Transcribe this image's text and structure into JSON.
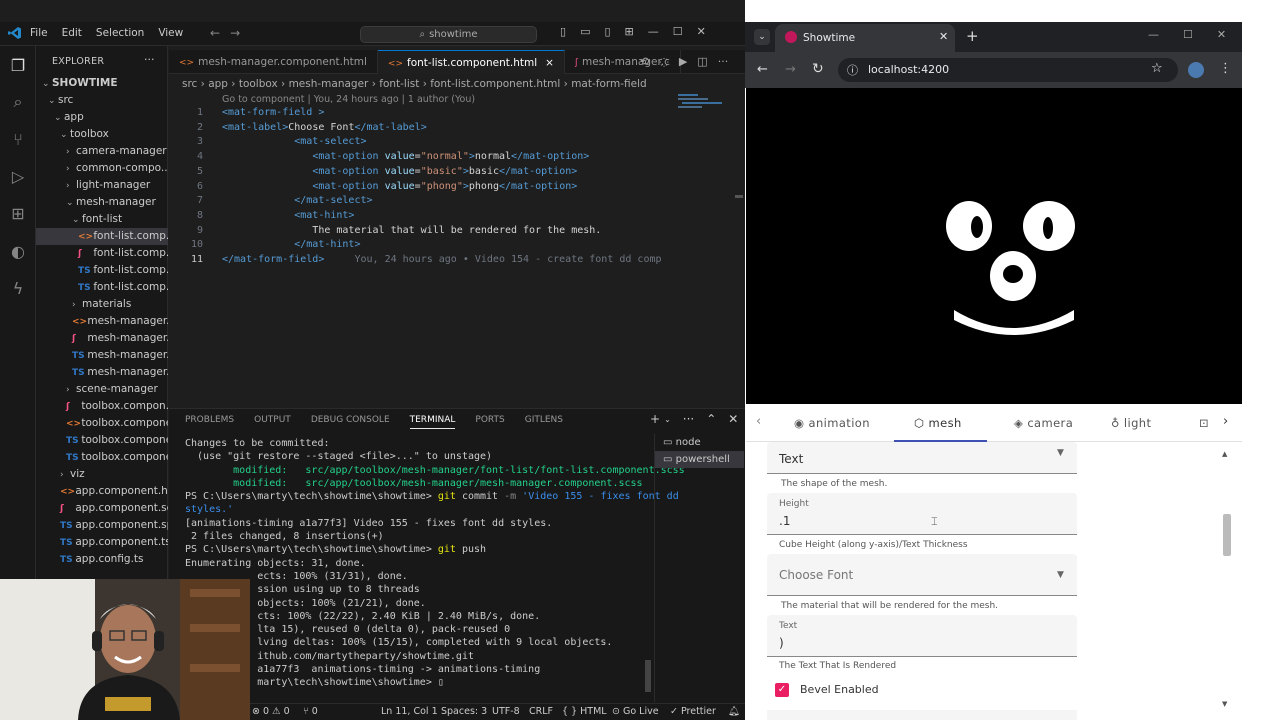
{
  "vscode": {
    "menu": [
      "File",
      "Edit",
      "Selection",
      "View"
    ],
    "command_center": "showtime",
    "explorer_title": "EXPLORER",
    "explorer_more": "···",
    "tree": [
      {
        "label": "SHOWTIME",
        "indent": 0,
        "chev": "⌄",
        "icon": "",
        "ic": "",
        "bold": true
      },
      {
        "label": "src",
        "indent": 1,
        "chev": "⌄",
        "icon": "",
        "ic": ""
      },
      {
        "label": "app",
        "indent": 2,
        "chev": "⌄",
        "icon": "",
        "ic": ""
      },
      {
        "label": "toolbox",
        "indent": 3,
        "chev": "⌄",
        "icon": "",
        "ic": ""
      },
      {
        "label": "camera-manager",
        "indent": 4,
        "chev": "›",
        "icon": "",
        "ic": ""
      },
      {
        "label": "common-compo...",
        "indent": 4,
        "chev": "›",
        "icon": "",
        "ic": ""
      },
      {
        "label": "light-manager",
        "indent": 4,
        "chev": "›",
        "icon": "",
        "ic": ""
      },
      {
        "label": "mesh-manager",
        "indent": 4,
        "chev": "⌄",
        "icon": "",
        "ic": ""
      },
      {
        "label": "font-list",
        "indent": 5,
        "chev": "⌄",
        "icon": "",
        "ic": ""
      },
      {
        "label": "font-list.comp...",
        "indent": 6,
        "chev": "",
        "icon": "<>",
        "ic": "#e37933",
        "sel": true
      },
      {
        "label": "font-list.comp...",
        "indent": 6,
        "chev": "",
        "icon": "ʃ",
        "ic": "#f55385"
      },
      {
        "label": "font-list.comp...",
        "indent": 6,
        "chev": "",
        "icon": "TS",
        "ic": "#3178c6"
      },
      {
        "label": "font-list.comp...",
        "indent": 6,
        "chev": "",
        "icon": "TS",
        "ic": "#3178c6"
      },
      {
        "label": "materials",
        "indent": 5,
        "chev": "›",
        "icon": "",
        "ic": ""
      },
      {
        "label": "mesh-manager....",
        "indent": 5,
        "chev": "",
        "icon": "<>",
        "ic": "#e37933"
      },
      {
        "label": "mesh-manager....",
        "indent": 5,
        "chev": "",
        "icon": "ʃ",
        "ic": "#f55385"
      },
      {
        "label": "mesh-manager....",
        "indent": 5,
        "chev": "",
        "icon": "TS",
        "ic": "#3178c6"
      },
      {
        "label": "mesh-manager....",
        "indent": 5,
        "chev": "",
        "icon": "TS",
        "ic": "#3178c6"
      },
      {
        "label": "scene-manager",
        "indent": 4,
        "chev": "›",
        "icon": "",
        "ic": ""
      },
      {
        "label": "toolbox.compon...",
        "indent": 4,
        "chev": "",
        "icon": "ʃ",
        "ic": "#f55385"
      },
      {
        "label": "toolbox.compone...",
        "indent": 4,
        "chev": "",
        "icon": "<>",
        "ic": "#e37933"
      },
      {
        "label": "toolbox.compone...",
        "indent": 4,
        "chev": "",
        "icon": "TS",
        "ic": "#3178c6"
      },
      {
        "label": "toolbox.compone...",
        "indent": 4,
        "chev": "",
        "icon": "TS",
        "ic": "#3178c6"
      },
      {
        "label": "viz",
        "indent": 3,
        "chev": "›",
        "icon": "",
        "ic": ""
      },
      {
        "label": "app.component.ht...",
        "indent": 3,
        "chev": "",
        "icon": "<>",
        "ic": "#e37933"
      },
      {
        "label": "app.component.scss",
        "indent": 3,
        "chev": "",
        "icon": "ʃ",
        "ic": "#f55385"
      },
      {
        "label": "app.component.sp...",
        "indent": 3,
        "chev": "",
        "icon": "TS",
        "ic": "#3178c6"
      },
      {
        "label": "app.component.ts",
        "indent": 3,
        "chev": "",
        "icon": "TS",
        "ic": "#3178c6"
      },
      {
        "label": "app.config.ts",
        "indent": 3,
        "chev": "",
        "icon": "TS",
        "ic": "#3178c6"
      }
    ],
    "tabs": [
      {
        "label": "mesh-manager.component.html",
        "icon": "<>",
        "active": false
      },
      {
        "label": "font-list.component.html",
        "icon": "<>",
        "active": true,
        "close": "×"
      },
      {
        "label": "mesh-manager.c",
        "icon": "ʃ",
        "active": false
      }
    ],
    "breadcrumb": "src › app › toolbox › mesh-manager › font-list › font-list.component.html › mat-form-field",
    "blame": "Go to component | You, 24 hours ago | 1 author (You)",
    "code_lines": [
      [
        [
          "tg",
          "<mat-form-field"
        ],
        [
          "tx",
          " "
        ],
        [
          "tg",
          ">"
        ]
      ],
      [
        [
          "tg",
          "<mat-label>"
        ],
        [
          "tx",
          "Choose Font"
        ],
        [
          "tg",
          "</mat-label>"
        ]
      ],
      [
        [
          "tx",
          "            "
        ],
        [
          "tg",
          "<mat-select>"
        ]
      ],
      [
        [
          "tx",
          "               "
        ],
        [
          "tg",
          "<mat-option "
        ],
        [
          "at",
          "value"
        ],
        [
          "tx",
          "="
        ],
        [
          "sv",
          "\"normal\""
        ],
        [
          "tg",
          ">"
        ],
        [
          "tx",
          "normal"
        ],
        [
          "tg",
          "</mat-option>"
        ]
      ],
      [
        [
          "tx",
          "               "
        ],
        [
          "tg",
          "<mat-option "
        ],
        [
          "at",
          "value"
        ],
        [
          "tx",
          "="
        ],
        [
          "sv",
          "\"basic\""
        ],
        [
          "tg",
          ">"
        ],
        [
          "tx",
          "basic"
        ],
        [
          "tg",
          "</mat-option>"
        ]
      ],
      [
        [
          "tx",
          "               "
        ],
        [
          "tg",
          "<mat-option "
        ],
        [
          "at",
          "value"
        ],
        [
          "tx",
          "="
        ],
        [
          "sv",
          "\"phong\""
        ],
        [
          "tg",
          ">"
        ],
        [
          "tx",
          "phong"
        ],
        [
          "tg",
          "</mat-option>"
        ]
      ],
      [
        [
          "tx",
          "            "
        ],
        [
          "tg",
          "</mat-select>"
        ]
      ],
      [
        [
          "tx",
          "            "
        ],
        [
          "tg",
          "<mat-hint>"
        ]
      ],
      [
        [
          "tx",
          "               The material that will be rendered for the mesh."
        ]
      ],
      [
        [
          "tx",
          "            "
        ],
        [
          "tg",
          "</mat-hint>"
        ]
      ],
      [
        [
          "tg",
          "</mat-form-field>"
        ],
        [
          "gh",
          "     You, 24 hours ago • Video 154 - create font dd comp"
        ]
      ]
    ],
    "panel_tabs": [
      "PROBLEMS",
      "OUTPUT",
      "DEBUG CONSOLE",
      "TERMINAL",
      "PORTS",
      "GITLENS"
    ],
    "panel_active": "TERMINAL",
    "terminal": [
      [
        "",
        "Changes to be committed:"
      ],
      [
        "",
        "  (use \"git restore --staged <file>...\" to unstage)"
      ],
      [
        "g",
        "        modified:   src/app/toolbox/mesh-manager/font-list/font-list.component.scss"
      ],
      [
        "g",
        "        modified:   src/app/toolbox/mesh-manager/mesh-manager.component.scss"
      ],
      [
        "",
        ""
      ],
      [
        "c",
        "PS C:\\Users\\marty\\tech\\showtime\\showtime> git commit -m 'Video 155 - fixes font dd"
      ],
      [
        "",
        ""
      ],
      [
        "",
        "styles.'"
      ],
      [
        "",
        "[animations-timing a1a77f3] Video 155 - fixes font dd styles."
      ],
      [
        "",
        " 2 files changed, 8 insertions(+)"
      ],
      [
        "p",
        "PS C:\\Users\\marty\\tech\\showtime\\showtime> git push"
      ],
      [
        "",
        "Enumerating objects: 31, done."
      ],
      [
        "",
        "            ects: 100% (31/31), done."
      ],
      [
        "",
        "            ssion using up to 8 threads"
      ],
      [
        "",
        "            objects: 100% (21/21), done."
      ],
      [
        "",
        "            cts: 100% (22/22), 2.40 KiB | 2.40 MiB/s, done."
      ],
      [
        "",
        "            lta 15), reused 0 (delta 0), pack-reused 0"
      ],
      [
        "",
        "            lving deltas: 100% (15/15), completed with 9 local objects."
      ],
      [
        "",
        "            ithub.com/martytheparty/showtime.git"
      ],
      [
        "",
        "            a1a77f3  animations-timing -> animations-timing"
      ],
      [
        "",
        "            marty\\tech\\showtime\\showtime> ▯"
      ]
    ],
    "shells": [
      "node",
      "powershell"
    ],
    "status": {
      "errors": "⊗ 0 ⚠ 0",
      "ports": "⑂ 0",
      "position": "Ln 11, Col 1",
      "spaces": "Spaces: 3",
      "encoding": "UTF-8",
      "eol": "CRLF",
      "lang": "{ } HTML",
      "golive": "⊙ Go Live",
      "prettier": "✓ Prettier"
    }
  },
  "browser": {
    "tab_title": "Showtime",
    "url": "localhost:4200",
    "mat_tabs": [
      "animation",
      "mesh",
      "camera",
      "light"
    ],
    "active_tab": "mesh",
    "form": {
      "shape_value": "Text",
      "shape_hint": "The shape of the mesh.",
      "height_label": "Height",
      "height_value": ".1",
      "height_hint": "Cube Height (along y-axis)/Text Thickness",
      "font_label": "Choose Font",
      "font_hint": "The material that will be rendered for the mesh.",
      "text_label": "Text",
      "text_value": ")",
      "text_hint": "The Text That Is Rendered",
      "bevel_label": "Bevel Enabled",
      "bevel_checked": true
    }
  },
  "colors": {
    "accent": "#0078d4",
    "checkbox": "#e91e63",
    "tab_ink": "#3f51b5"
  }
}
